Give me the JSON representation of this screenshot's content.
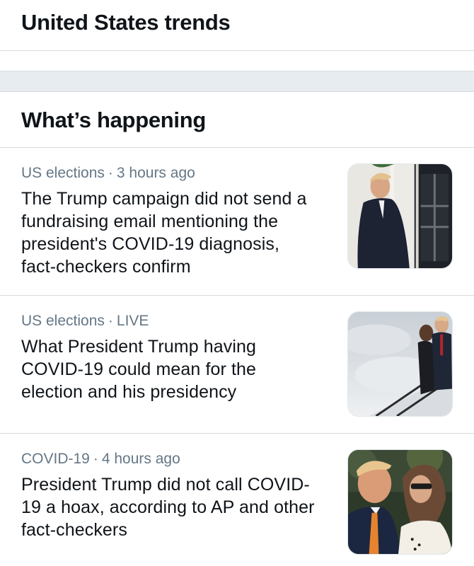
{
  "header": {
    "title": "United States trends"
  },
  "section": {
    "title": "What’s happening"
  },
  "stories": [
    {
      "category": "US elections",
      "time": "3 hours ago",
      "headline": "The Trump campaign did not send a fundraising email mentioning the president's COVID-19 diagnosis, fact-checkers confirm",
      "image": "photo-trump-walking-doorway"
    },
    {
      "category": "US elections",
      "time": "LIVE",
      "headline": "What President Trump having COVID-19 could mean for the election and his presidency",
      "image": "photo-trump-airplane-stairs"
    },
    {
      "category": "COVID-19",
      "time": "4 hours ago",
      "headline": "President Trump did not call COVID-19 a hoax, according to AP and other fact-checkers",
      "image": "photo-trump-and-first-lady"
    }
  ]
}
